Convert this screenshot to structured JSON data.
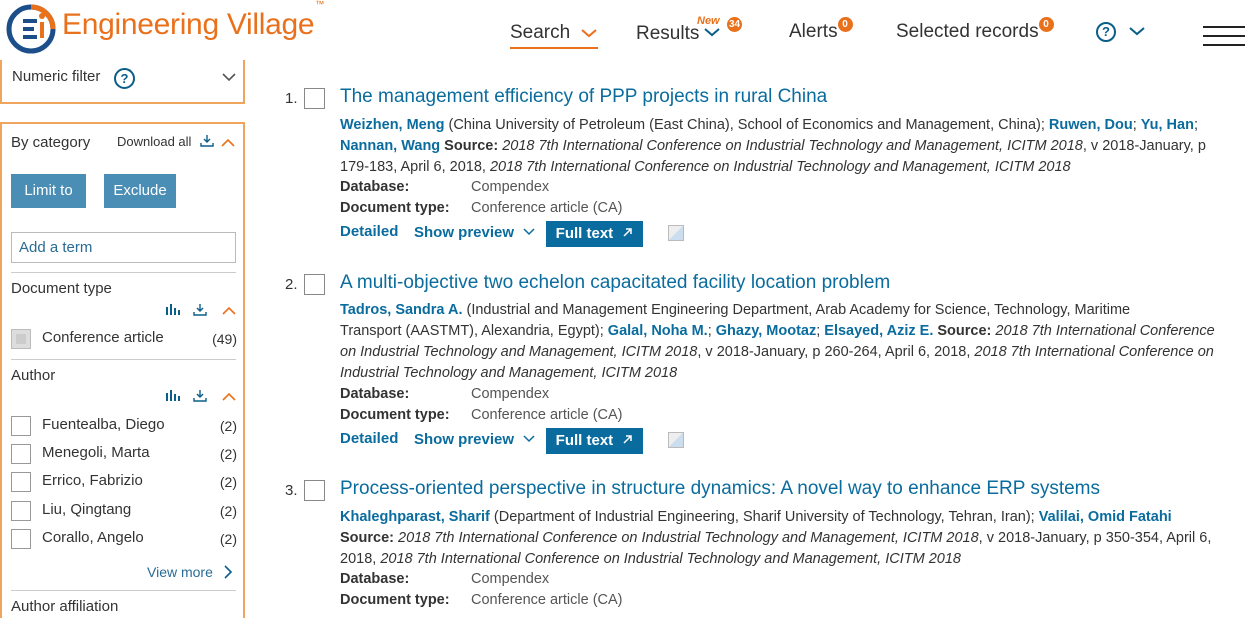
{
  "header": {
    "brand": "Engineering Village",
    "trademark": "™",
    "nav": {
      "search": "Search",
      "results": "Results",
      "results_new": "New",
      "results_count": "34",
      "alerts": "Alerts",
      "alerts_count": "0",
      "selected": "Selected records",
      "selected_count": "0"
    },
    "help": "?"
  },
  "sidebar": {
    "numeric_filter": "Numeric filter",
    "numeric_help": "?",
    "by_category": "By category",
    "download_all": "Download all",
    "limit_to": "Limit to",
    "exclude": "Exclude",
    "add_term_placeholder": "Add a term",
    "document_type": {
      "title": "Document type",
      "items": [
        {
          "label": "Conference article",
          "count": "(49)"
        }
      ]
    },
    "author": {
      "title": "Author",
      "items": [
        {
          "label": "Fuentealba, Diego",
          "count": "(2)"
        },
        {
          "label": "Menegoli, Marta",
          "count": "(2)"
        },
        {
          "label": "Errico, Fabrizio",
          "count": "(2)"
        },
        {
          "label": "Liu, Qingtang",
          "count": "(2)"
        },
        {
          "label": "Corallo, Angelo",
          "count": "(2)"
        }
      ]
    },
    "view_more": "View more",
    "author_affiliation": "Author affiliation"
  },
  "results": [
    {
      "num": "1.",
      "title": "The management efficiency of PPP projects in rural China",
      "line1_a1": "Weizhen, Meng",
      "line1_t1": " (China University of Petroleum (East China), School of Economics and Management, China); ",
      "line1_a2": "Ruwen, Dou",
      "line1_sep": "; ",
      "line1_a3": "Yu, Han",
      "line1_sep2": ";",
      "line2_a4": "Nannan, Wang",
      "source_label": " Source: ",
      "source_conf": "2018 7th International Conference on Industrial Technology and Management, ICITM 2018",
      "source_tail": ", v 2018-January, p",
      "line3": "179-183, April 6, 2018, ",
      "line3_conf": "2018 7th International Conference on Industrial Technology and Management, ICITM 2018",
      "database_label": "Database:",
      "database": "Compendex",
      "doctype_label": "Document type:",
      "doctype": "Conference article (CA)",
      "detailed": "Detailed",
      "show_preview": "Show preview",
      "full_text": "Full text"
    },
    {
      "num": "2.",
      "title": "A multi-objective two echelon capacitated facility location problem",
      "a1": "Tadros, Sandra A.",
      "t1": " (Industrial and Management Engineering Department, Arab Academy for Science, Technology, Maritime",
      "t2": "Transport (AASTMT), Alexandria, Egypt); ",
      "a2": "Galal, Noha M.",
      "sep1": "; ",
      "a3": "Ghazy, Mootaz",
      "sep2": "; ",
      "a4": "Elsayed, Aziz E.",
      "source_label": " Source: ",
      "conf_a": "2018 7th International Conference",
      "line3": "on Industrial Technology and Management, ICITM 2018",
      "line3_tail": ", v 2018-January, p 260-264, April 6, 2018, ",
      "line3_conf": "2018 7th International Conference on",
      "line4": "Industrial Technology and Management, ICITM 2018",
      "database_label": "Database:",
      "database": "Compendex",
      "doctype_label": "Document type:",
      "doctype": "Conference article (CA)",
      "detailed": "Detailed",
      "show_preview": "Show preview",
      "full_text": "Full text"
    },
    {
      "num": "3.",
      "title": "Process-oriented perspective in structure dynamics: A novel way to enhance ERP systems",
      "a1": "Khaleghparast, Sharif",
      "t1": " (Department of Industrial Engineering, Sharif University of Technology, Tehran, Iran); ",
      "a2": "Valilai, Omid Fatahi",
      "source_label": "Source: ",
      "conf": "2018 7th International Conference on Industrial Technology and Management, ICITM 2018",
      "tail": ", v 2018-January, p 350-354, April 6,",
      "line3": "2018, ",
      "line3_conf": "2018 7th International Conference on Industrial Technology and Management, ICITM 2018",
      "database_label": "Database:",
      "database": "Compendex",
      "doctype_label": "Document type:",
      "doctype": "Conference article (CA)"
    }
  ]
}
